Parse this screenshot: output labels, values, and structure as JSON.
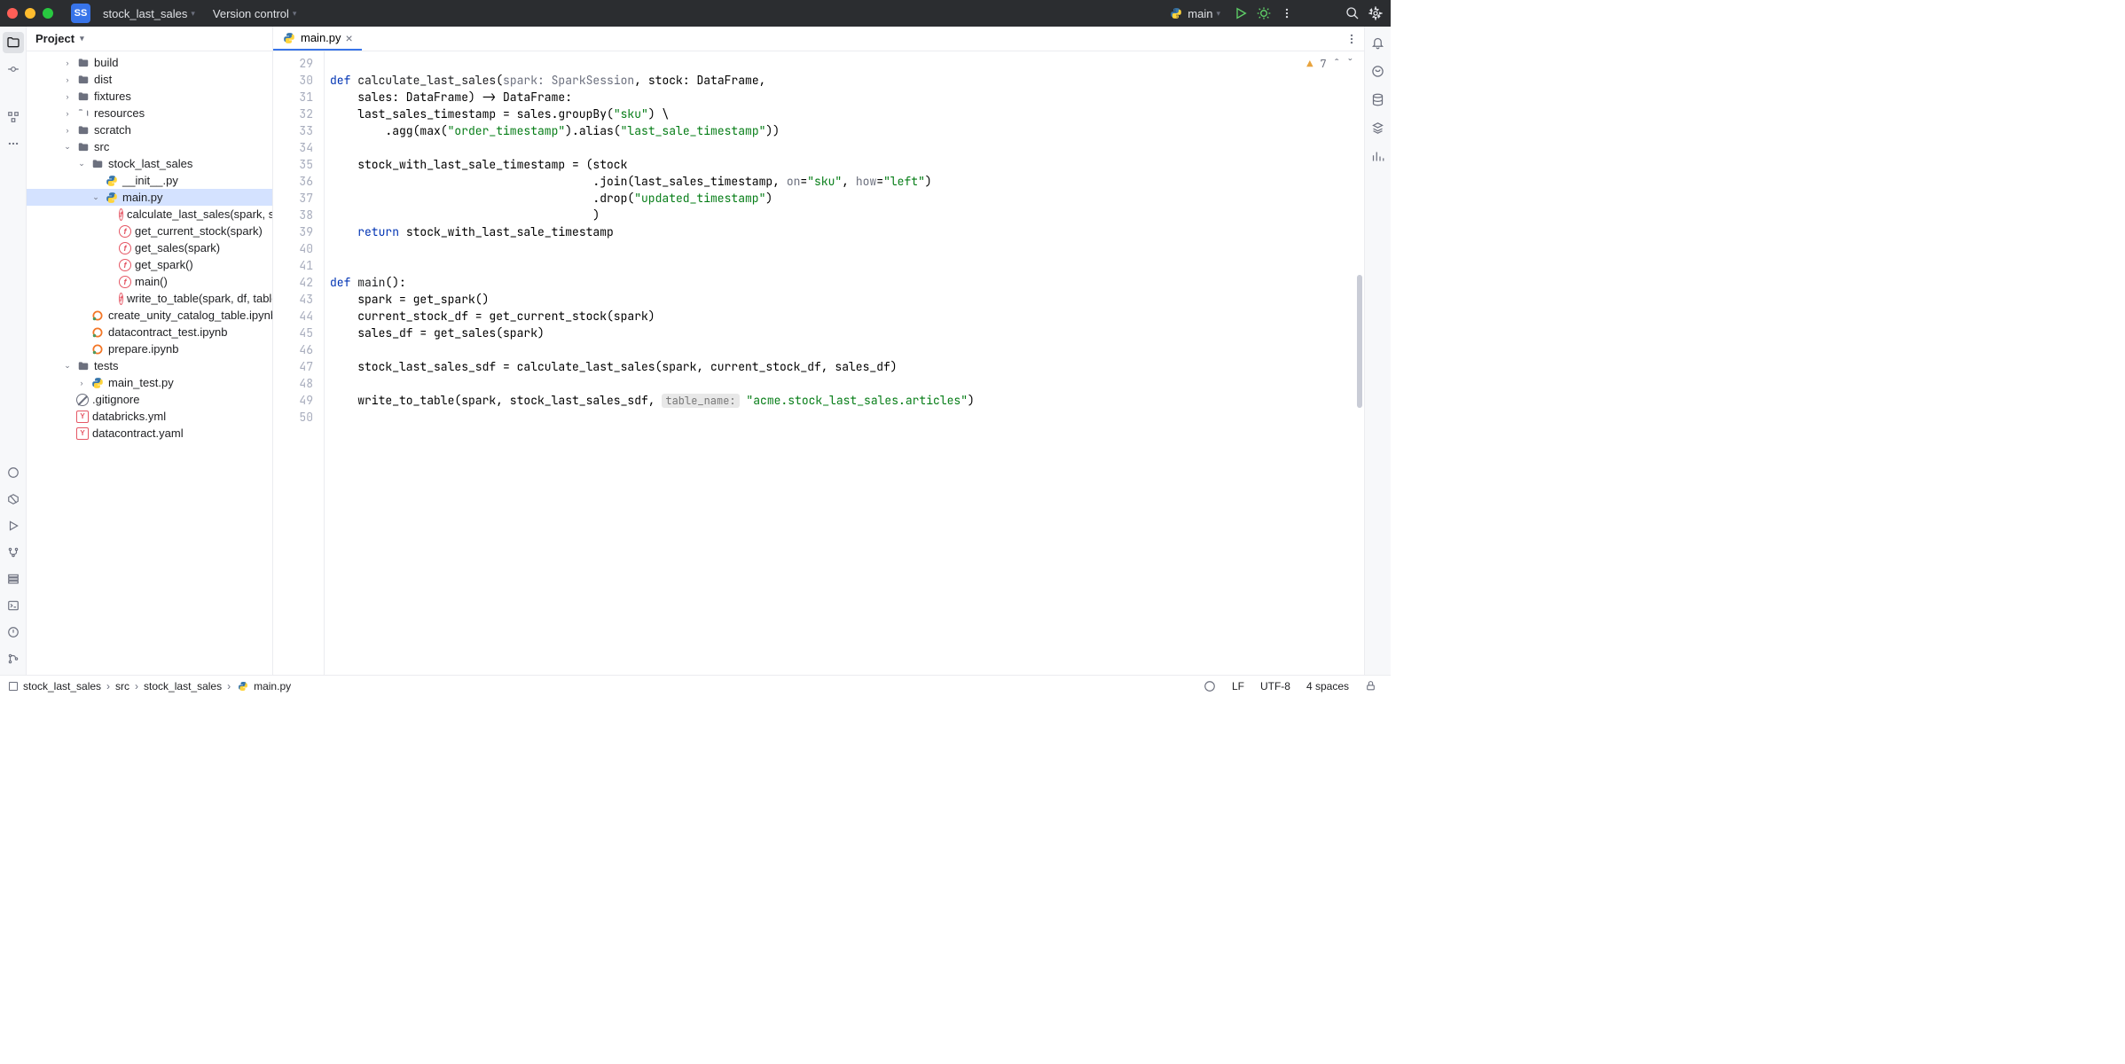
{
  "titlebar": {
    "project_badge": "SS",
    "project_name": "stock_last_sales",
    "vcs_label": "Version control",
    "run_config": "main"
  },
  "project_panel": {
    "title": "Project"
  },
  "tree": {
    "build": "build",
    "dist": "dist",
    "fixtures": "fixtures",
    "resources": "resources",
    "scratch": "scratch",
    "src": "src",
    "stock_last_sales_pkg": "stock_last_sales",
    "init": "__init__.py",
    "mainpy": "main.py",
    "fn_calc": "calculate_last_sales(spark, stock",
    "fn_get_stock": "get_current_stock(spark)",
    "fn_get_sales": "get_sales(spark)",
    "fn_get_spark": "get_spark()",
    "fn_main": "main()",
    "fn_write": "write_to_table(spark, df, table_n",
    "nb_create": "create_unity_catalog_table.ipynb",
    "nb_dctest": "datacontract_test.ipynb",
    "nb_prepare": "prepare.ipynb",
    "tests": "tests",
    "main_test": "main_test.py",
    "gitignore": ".gitignore",
    "dbyml": "databricks.yml",
    "dcyaml": "datacontract.yaml"
  },
  "tab": {
    "label": "main.py"
  },
  "issues": {
    "count": "7"
  },
  "code": {
    "lines": [
      {
        "n": "29",
        "raw": ""
      },
      {
        "n": "30",
        "tok": [
          [
            "kw",
            "def "
          ],
          [
            "fn",
            "calculate_last_sales"
          ],
          [
            "",
            "("
          ],
          [
            "param",
            "spark: SparkSession"
          ],
          [
            "",
            ", "
          ],
          [
            "",
            "stock: DataFrame,"
          ]
        ]
      },
      {
        "n": "31",
        "tok": [
          [
            "",
            "    sales: DataFrame) -> DataFrame:"
          ]
        ]
      },
      {
        "n": "32",
        "tok": [
          [
            "",
            "    last_sales_timestamp = sales.groupBy("
          ],
          [
            "str",
            "\"sku\""
          ],
          [
            "",
            ") \\"
          ]
        ]
      },
      {
        "n": "33",
        "tok": [
          [
            "",
            "        .agg(max("
          ],
          [
            "str",
            "\"order_timestamp\""
          ],
          [
            "",
            ").alias("
          ],
          [
            "str",
            "\"last_sale_timestamp\""
          ],
          [
            "",
            "))"
          ]
        ]
      },
      {
        "n": "34",
        "raw": ""
      },
      {
        "n": "35",
        "tok": [
          [
            "",
            "    stock_with_last_sale_timestamp = (stock"
          ]
        ]
      },
      {
        "n": "36",
        "tok": [
          [
            "",
            "                                      .join(last_sales_timestamp, "
          ],
          [
            "param",
            "on"
          ],
          [
            "",
            "="
          ],
          [
            "str",
            "\"sku\""
          ],
          [
            "",
            ", "
          ],
          [
            "param",
            "how"
          ],
          [
            "",
            "="
          ],
          [
            "str",
            "\"left\""
          ],
          [
            "",
            ")"
          ]
        ]
      },
      {
        "n": "37",
        "tok": [
          [
            "",
            "                                      .drop("
          ],
          [
            "str",
            "\"updated_timestamp\""
          ],
          [
            "",
            ")"
          ]
        ]
      },
      {
        "n": "38",
        "tok": [
          [
            "",
            "                                      )"
          ]
        ]
      },
      {
        "n": "39",
        "tok": [
          [
            "",
            "    "
          ],
          [
            "kw",
            "return"
          ],
          [
            "",
            " stock_with_last_sale_timestamp"
          ]
        ]
      },
      {
        "n": "40",
        "raw": ""
      },
      {
        "n": "41",
        "raw": ""
      },
      {
        "n": "42",
        "tok": [
          [
            "kw",
            "def "
          ],
          [
            "fn",
            "main"
          ],
          [
            "",
            "():"
          ]
        ]
      },
      {
        "n": "43",
        "tok": [
          [
            "",
            "    spark = get_spark()"
          ]
        ]
      },
      {
        "n": "44",
        "tok": [
          [
            "",
            "    current_stock_df = get_current_stock(spark)"
          ]
        ]
      },
      {
        "n": "45",
        "tok": [
          [
            "",
            "    sales_df = get_sales(spark)"
          ]
        ]
      },
      {
        "n": "46",
        "raw": ""
      },
      {
        "n": "47",
        "tok": [
          [
            "",
            "    stock_last_sales_sdf = calculate_last_sales(spark, current_stock_df, sales_df)"
          ]
        ]
      },
      {
        "n": "48",
        "raw": ""
      },
      {
        "n": "49",
        "tok": [
          [
            "",
            "    write_to_table(spark, stock_last_sales_sdf, "
          ],
          [
            "inlay",
            "table_name:"
          ],
          [
            "",
            " "
          ],
          [
            "str",
            "\"acme.stock_last_sales.articles\""
          ],
          [
            "",
            ")"
          ]
        ]
      },
      {
        "n": "50",
        "raw": ""
      }
    ]
  },
  "breadcrumbs": {
    "c1": "stock_last_sales",
    "c2": "src",
    "c3": "stock_last_sales",
    "c4": "main.py"
  },
  "status": {
    "line_ending": "LF",
    "encoding": "UTF-8",
    "indent": "4 spaces"
  }
}
